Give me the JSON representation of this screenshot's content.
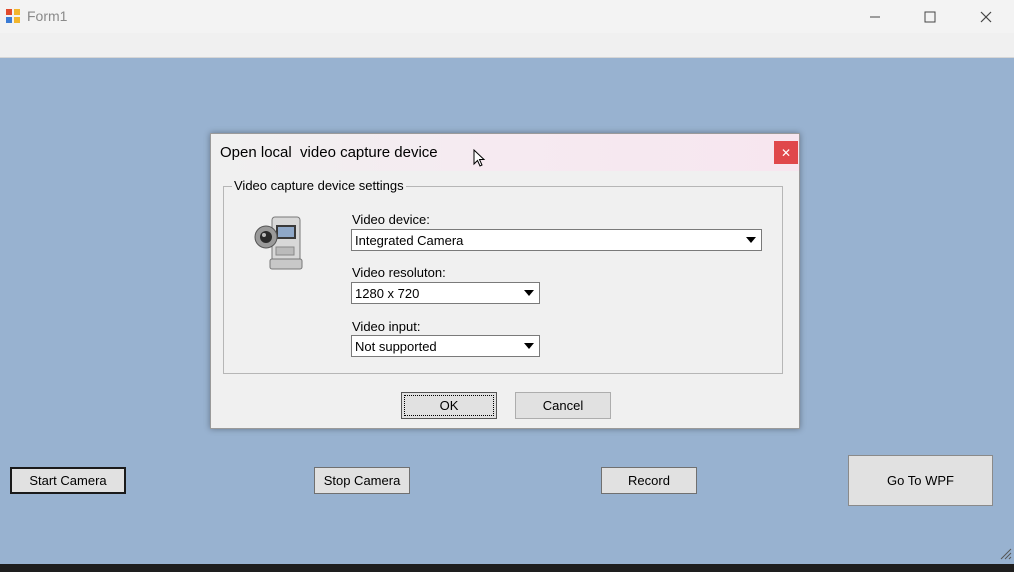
{
  "window": {
    "title": "Form1"
  },
  "buttons": {
    "start_camera": "Start Camera",
    "stop_camera": "Stop Camera",
    "record": "Record",
    "go_to_wpf": "Go To WPF"
  },
  "dialog": {
    "title": "Open local  video capture device",
    "close_glyph": "✕",
    "group_title": "Video capture device settings",
    "video_device": {
      "label": "Video device:",
      "value": "Integrated Camera"
    },
    "video_resolution": {
      "label": "Video resoluton:",
      "value": "1280 x 720"
    },
    "video_input": {
      "label": "Video input:",
      "value": "Not supported"
    },
    "ok_label": "OK",
    "cancel_label": "Cancel"
  },
  "colors": {
    "window_bg": "#98b2d0",
    "dialog_bg": "#f0f0f0",
    "close_red": "#e0484b"
  }
}
